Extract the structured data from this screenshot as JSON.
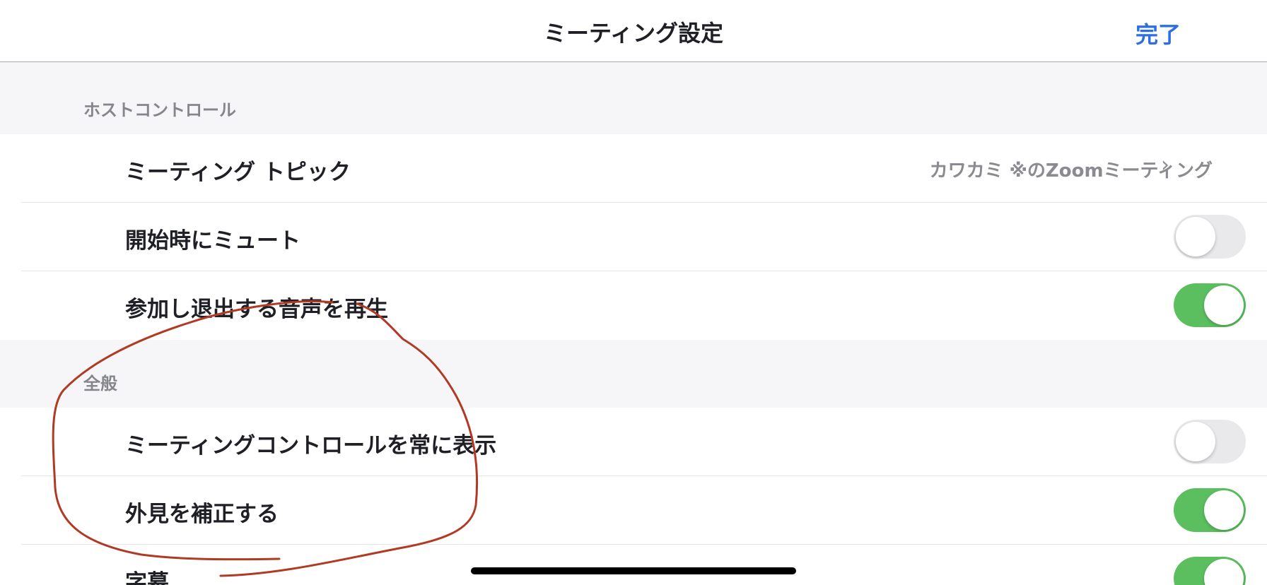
{
  "header": {
    "title": "ミーティング設定",
    "done_label": "完了"
  },
  "sections": {
    "host_control": {
      "header": "ホストコントロール",
      "meeting_topic": {
        "label": "ミーティング トピック",
        "value": "カワカミ ※のZoomミーティング",
        "chevron": "›"
      },
      "mute_on_start": {
        "label": "開始時にミュート",
        "toggle": false
      },
      "join_leave_sound": {
        "label": "参加し退出する音声を再生",
        "toggle": true
      }
    },
    "general": {
      "header": "全般",
      "always_show_controls": {
        "label": "ミーティングコントロールを常に表示",
        "toggle": false
      },
      "touch_up_appearance": {
        "label": "外見を補正する",
        "toggle": true
      },
      "captions": {
        "label": "字幕",
        "toggle": true
      }
    }
  },
  "colors": {
    "accent": "#2d6fe0",
    "toggle_on": "#5bbf5f",
    "toggle_off": "#e9e9eb",
    "annotation": "#b03a24"
  }
}
